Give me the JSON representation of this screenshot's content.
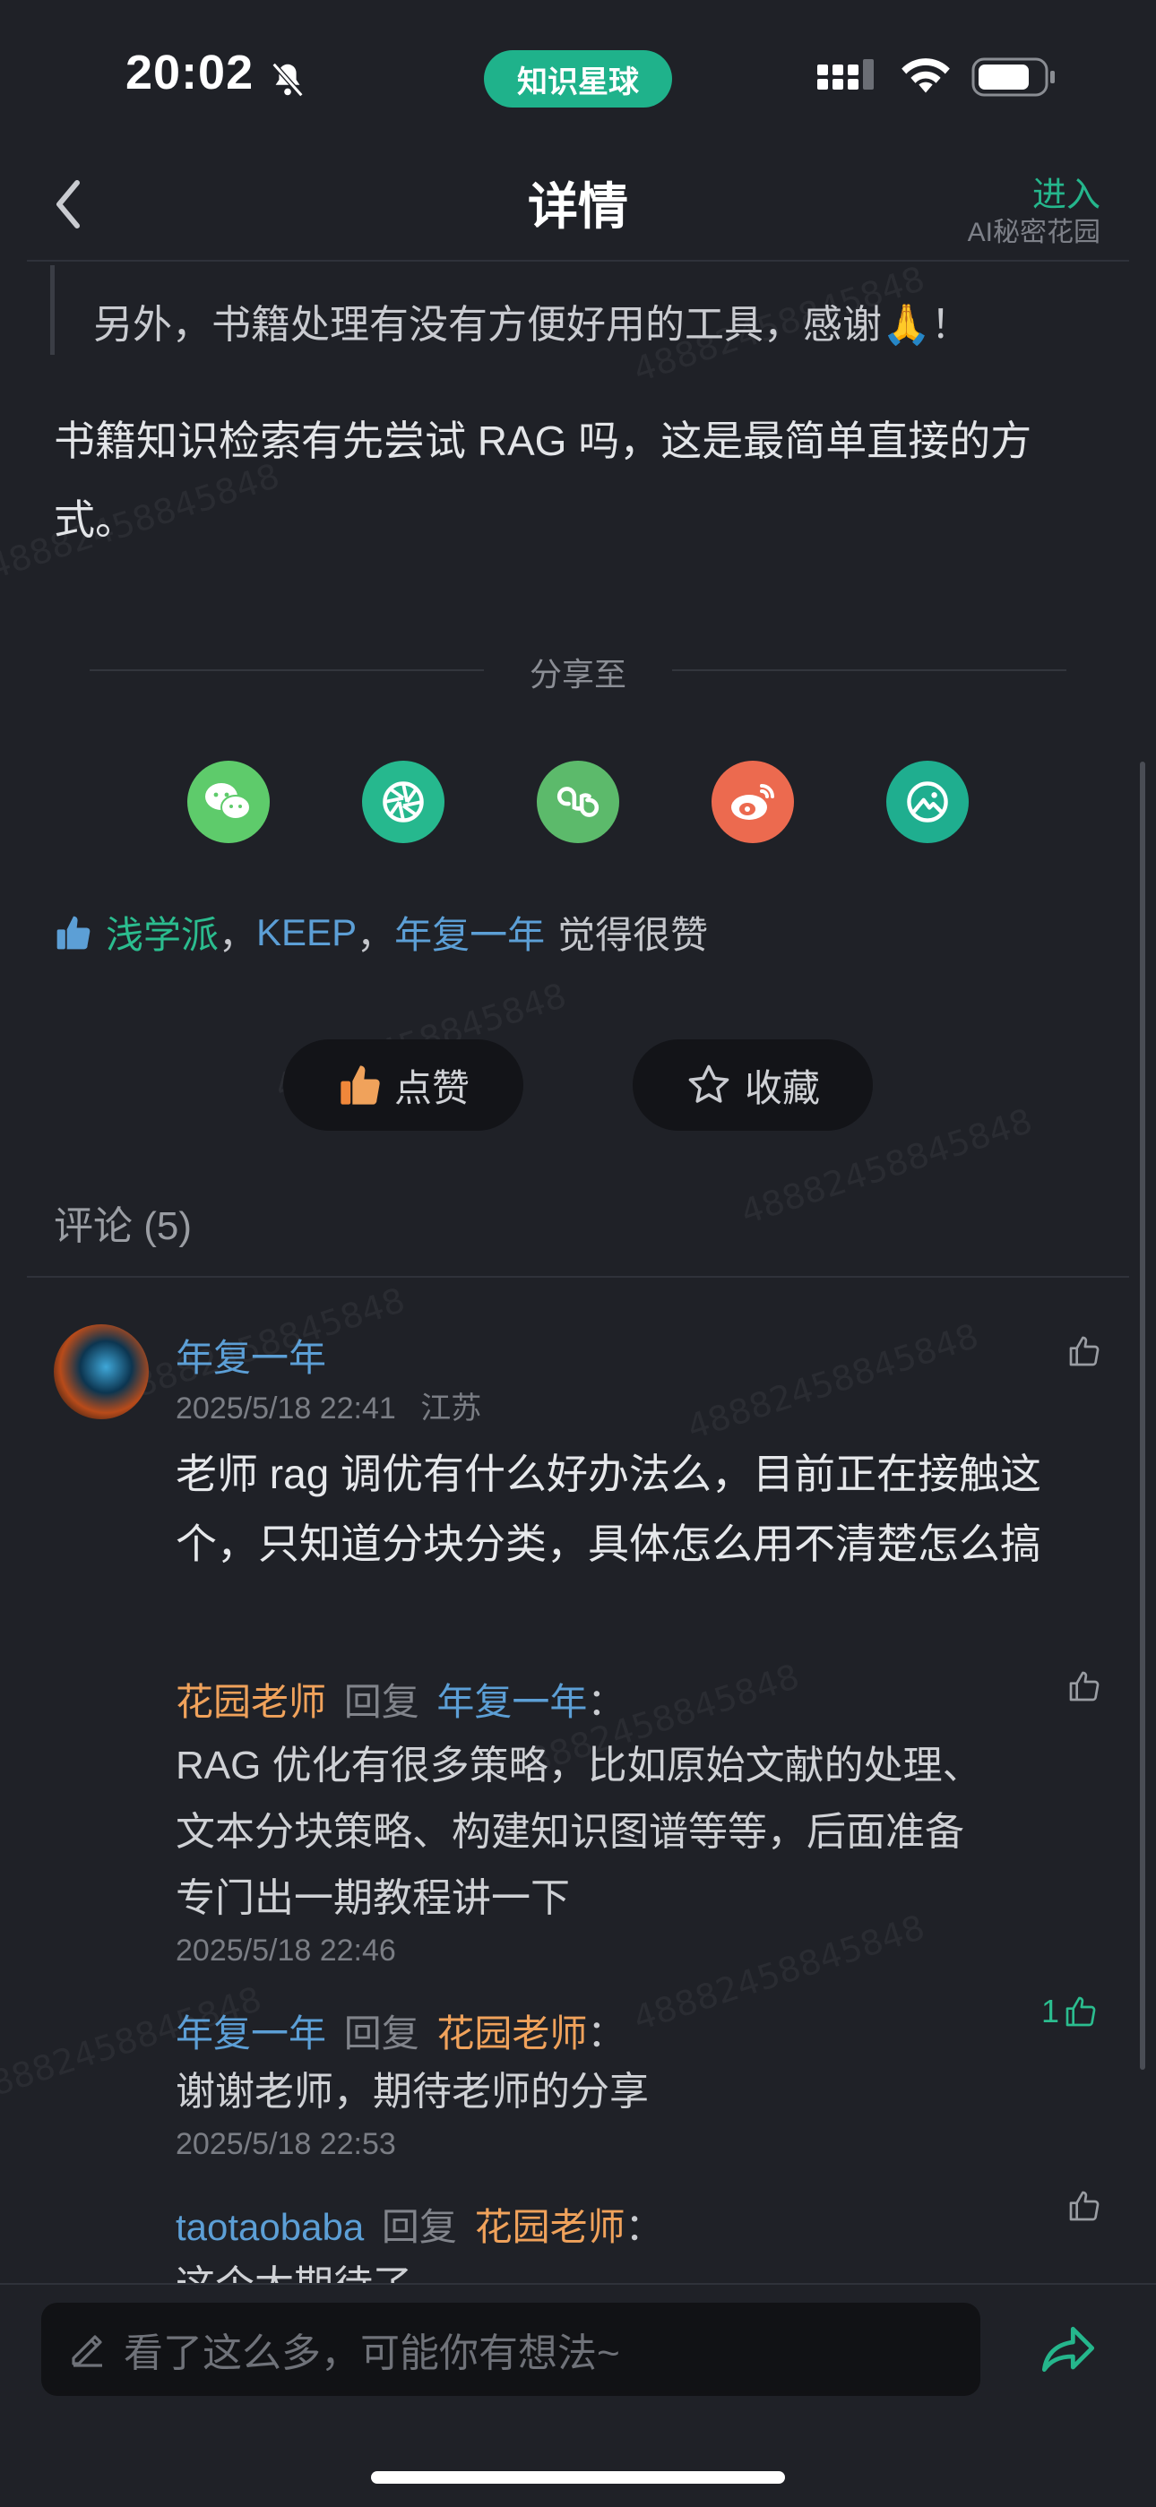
{
  "status_bar": {
    "time": "20:02",
    "center_pill": "知识星球"
  },
  "header": {
    "title": "详情",
    "enter_label": "进入",
    "group_name": "AI秘密花园"
  },
  "post": {
    "quote": "另外，书籍处理有没有方便好用的工具，感谢🙏！",
    "body": "书籍知识检索有先尝试 RAG 吗，这是最简单直接的方式。"
  },
  "share": {
    "label": "分享至",
    "targets": [
      "wechat-icon",
      "moments-icon",
      "mini-program-icon",
      "weibo-icon",
      "save-image-icon"
    ],
    "colors": {
      "wechat": "#5ecb6b",
      "moments": "#26b88e",
      "mini": "#5cba6b",
      "weibo": "#ec6a4f",
      "image": "#1fae8f"
    }
  },
  "likes": {
    "users": [
      "浅学派",
      "KEEP",
      "年复一年"
    ],
    "separator": "，",
    "suffix": "觉得很赞"
  },
  "actions": {
    "like": "点赞",
    "favorite": "收藏"
  },
  "comments_section": {
    "title": "评论 (5)"
  },
  "comments": [
    {
      "author": "年复一年",
      "time": "2025/5/18 22:41",
      "location": "江苏",
      "text": "老师 rag 调优有什么好办法么，目前正在接触这个，只知道分块分类，具体怎么用不清楚怎么搞",
      "replies": [
        {
          "from": "花园老师",
          "verb": "回复",
          "to": "年复一年",
          "colon": "：",
          "text": "RAG 优化有很多策略，比如原始文献的处理、文本分块策略、构建知识图谱等等，后面准备专门出一期教程讲一下",
          "time": "2025/5/18 22:46",
          "likes": ""
        },
        {
          "from": "年复一年",
          "verb": "回复",
          "to": "花园老师",
          "colon": "：",
          "text": "谢谢老师，期待老师的分享",
          "time": "2025/5/18 22:53",
          "likes": "1"
        },
        {
          "from": "taotaobaba",
          "verb": "回复",
          "to": "花园老师",
          "colon": "：",
          "text": "这个太期待了",
          "time": "",
          "likes": ""
        }
      ]
    }
  ],
  "input": {
    "placeholder": "看了这么多，可能你有想法~"
  },
  "watermark": "48882458845848"
}
